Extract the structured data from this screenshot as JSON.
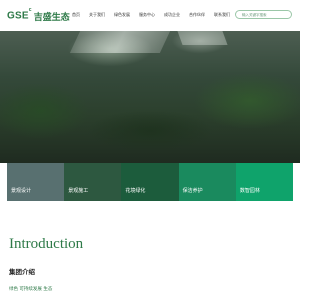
{
  "header": {
    "logo_text": "GSE",
    "logo_superscript": "c",
    "logo_cn": "吉盛生态",
    "nav_items": [
      "首页",
      "关于我们",
      "绿色发展",
      "服务中心",
      "成功企业",
      "合作伙伴",
      "联系我们"
    ],
    "search_placeholder": "输入关键字搜索"
  },
  "services": [
    {
      "label": "景观设计",
      "color": "#587070"
    },
    {
      "label": "景观施工",
      "color": "#2d5840"
    },
    {
      "label": "花境绿化",
      "color": "#1c5c3c"
    },
    {
      "label": "保洁养护",
      "color": "#1a8a5e"
    },
    {
      "label": "数智园林",
      "color": "#0fa36b"
    }
  ],
  "intro": {
    "title_en": "Introduction",
    "title_cn": "集团介绍",
    "tagline": "绿色 可持续发展 生态"
  },
  "colors": {
    "brand": "#2e7a48",
    "search_border": "#9bc7a8"
  }
}
